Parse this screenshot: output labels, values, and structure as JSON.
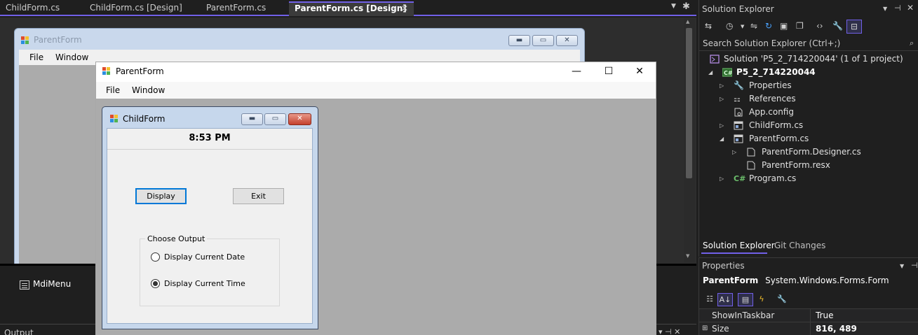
{
  "tabs": [
    {
      "label": "ChildForm.cs",
      "active": false
    },
    {
      "label": "ChildForm.cs [Design]",
      "active": false
    },
    {
      "label": "ParentForm.cs",
      "active": false
    },
    {
      "label": "ParentForm.cs [Design]",
      "active": true
    }
  ],
  "designer": {
    "parent_title": "ParentForm",
    "menu": [
      "File",
      "Window"
    ],
    "tray_component": "MdiMenu"
  },
  "runtime_parent": {
    "title": "ParentForm",
    "menu": [
      "File",
      "Window"
    ]
  },
  "child": {
    "title": "ChildForm",
    "time": "8:53 PM",
    "display_button": "Display",
    "exit_button": "Exit",
    "group_label": "Choose Output",
    "radio_date": "Display Current Date",
    "radio_time": "Display Current Time",
    "selected": "time"
  },
  "solution_explorer": {
    "title": "Solution Explorer",
    "search_placeholder": "Search Solution Explorer (Ctrl+;)",
    "tree": [
      {
        "label": "Solution 'P5_2_714220044' (1 of 1 project)",
        "icon": "solution-icon"
      },
      {
        "label": "P5_2_714220044",
        "icon": "csharp-project-icon"
      },
      {
        "label": "Properties",
        "icon": "wrench-icon"
      },
      {
        "label": "References",
        "icon": "references-icon"
      },
      {
        "label": "App.config",
        "icon": "config-file-icon"
      },
      {
        "label": "ChildForm.cs",
        "icon": "form-file-icon"
      },
      {
        "label": "ParentForm.cs",
        "icon": "form-file-icon"
      },
      {
        "label": "ParentForm.Designer.cs",
        "icon": "code-file-icon"
      },
      {
        "label": "ParentForm.resx",
        "icon": "resource-file-icon"
      },
      {
        "label": "Program.cs",
        "icon": "csharp-file-icon"
      }
    ],
    "tab_se": "Solution Explorer",
    "tab_git": "Git Changes"
  },
  "properties": {
    "title": "Properties",
    "object_name": "ParentForm",
    "object_type": "System.Windows.Forms.Form",
    "rows": [
      {
        "name": "ShowInTaskbar",
        "value": "True"
      },
      {
        "name": "Size",
        "value": "816, 489"
      }
    ]
  },
  "output": {
    "title": "Output"
  },
  "colors": {
    "accent": "#7160e8",
    "focus_blue": "#0078d7",
    "mdi_client": "#ababab"
  }
}
